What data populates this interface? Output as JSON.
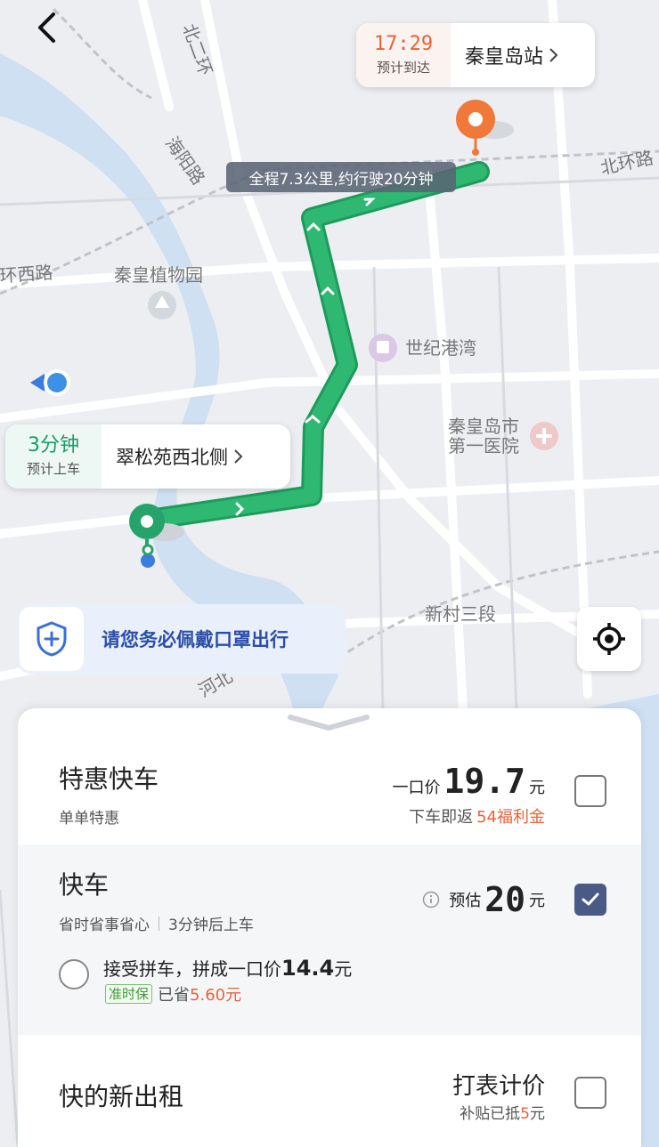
{
  "map": {
    "labels": {
      "north_second_ring": "北二环",
      "haiyang_road": "海阳路",
      "north_ring_road": "北环路",
      "ring_west_road": "环西路",
      "botanical_garden": "秦皇植物园",
      "century_harbor": "世纪港湾",
      "hospital_line1": "秦皇岛市",
      "hospital_line2": "第一医院",
      "xincun": "新村三段",
      "hebei": "河北"
    },
    "route_color": "#2eb872"
  },
  "destination": {
    "time": "17:29",
    "eta_label": "预计到达",
    "name": "秦皇岛站"
  },
  "route_summary": "全程7.3公里,约行驶20分钟",
  "pickup": {
    "time": "3分钟",
    "label": "预计上车",
    "name": "翠松苑西北侧"
  },
  "banner": {
    "text": "请您务必佩戴口罩出行"
  },
  "options": {
    "special_express": {
      "title": "特惠快车",
      "subtitle": "单单特惠",
      "price_prefix": "一口价",
      "price": "19.7",
      "unit": "元",
      "rebate_prefix": "下车即返",
      "rebate_value": "54福利金",
      "checked": false
    },
    "express": {
      "title": "快车",
      "subtitle_a": "省时省事省心",
      "subtitle_b": "3分钟后上车",
      "price_prefix": "预估",
      "price": "20",
      "unit": "元",
      "checked": true,
      "carpool_text": "接受拼车，拼成一口价",
      "carpool_price": "14.4",
      "carpool_unit": "元",
      "carpool_tag": "准时保",
      "carpool_saved_prefix": "已省",
      "carpool_saved": "5.60元"
    },
    "taxi": {
      "title": "快的新出租",
      "price_label": "打表计价",
      "subsidy_prefix": "补贴已抵",
      "subsidy_value": "5",
      "subsidy_unit": "元",
      "checked": false
    }
  }
}
